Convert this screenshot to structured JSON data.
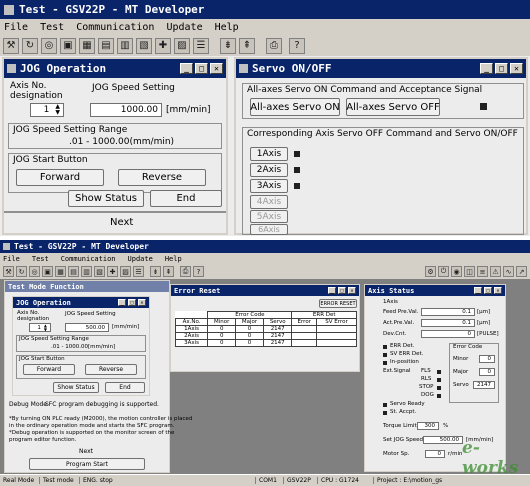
{
  "top": {
    "title": "Test - GSV22P - MT Developer",
    "menu": [
      "File",
      "Test",
      "Communication",
      "Update",
      "Help"
    ],
    "jog": {
      "title": "JOG Operation",
      "axis_no_label": "Axis No.",
      "designation_label": "designation",
      "axis_value": "1",
      "speed_setting_label": "JOG Speed Setting",
      "speed_value": "1000.00",
      "speed_unit": "[mm/min]",
      "range_label": "JOG Speed Setting Range",
      "range_value": ".01 - 1000.00(mm/min)",
      "start_label": "JOG Start Button",
      "forward": "Forward",
      "reverse": "Reverse",
      "show_status": "Show Status",
      "end": "End",
      "below_text": "Next"
    },
    "servo": {
      "title": "Servo ON/OFF",
      "all_group_label": "All-axes Servo ON Command and Acceptance Signal",
      "all_on": "All-axes Servo ON",
      "all_off": "All-axes Servo OFF",
      "axis_group_label": "Corresponding Axis Servo OFF Command and Servo ON/OFF",
      "axes": [
        "1Axis",
        "2Axis",
        "3Axis",
        "4Axis",
        "5Axis",
        "6Axis"
      ]
    }
  },
  "bottom": {
    "title": "Test - GSV22P - MT Developer",
    "menu": [
      "File",
      "Test",
      "Communication",
      "Update",
      "Help"
    ],
    "mode_title": "Test Mode Function",
    "jog": {
      "title": "JOG Operation",
      "axis_no_label": "Axis No.",
      "designation_label": "designation",
      "axis_value": "1",
      "speed_setting_label": "JOG Speed Setting",
      "speed_value": "500.00",
      "speed_unit": "[mm/min]",
      "range_label": "JOG Speed Setting Range",
      "range_value": ".01 - 1000.00[mm/min]",
      "start_label": "JOG Start Button",
      "forward": "Forward",
      "reverse": "Reverse",
      "show_status": "Show Status",
      "end": "End"
    },
    "debug_mode_label": "Debug Mode",
    "debug_mode_text": "SFC program debugging is supported.",
    "notes": [
      "*By turning ON PLC ready (M2000), the motion controller is placed",
      "  in the ordinary operation mode and starts the SFC program.",
      "  *Debug operation is supported on the monitor screen of the",
      "  program editor function."
    ],
    "next_label": "Next",
    "program_start": "Program Start",
    "error_reset_win": {
      "title": "Error Reset",
      "button": "ERROR RESET",
      "headers_top": [
        "Error Code",
        "ERR Det"
      ],
      "headers": [
        "Ax.No.",
        "Minor",
        "Major",
        "Servo",
        "Error",
        "SV Error"
      ],
      "rows": [
        [
          "1Axis",
          "0",
          "0",
          "2147",
          "",
          ""
        ],
        [
          "2Axis",
          "0",
          "0",
          "2147",
          "",
          ""
        ],
        [
          "3Axis",
          "0",
          "0",
          "2147",
          "",
          ""
        ]
      ]
    },
    "axis_status": {
      "title": "Axis Status",
      "axis_label": "1Axis",
      "feed_label": "Feed Pre.Val.",
      "feed_value": "0.1",
      "feed_unit": "[µm]",
      "act_label": "Act.Pre.Val.",
      "act_value": "0.1",
      "act_unit": "[µm]",
      "dev_label": "Dev.Cnt.",
      "dev_value": "0",
      "dev_unit": "[PULSE]",
      "err_det": "ERR Det.",
      "sv_err_det": "SV ERR Det.",
      "in_position": "In-position",
      "ext_signal": "Ext.Signal",
      "ext_items": [
        "FLS",
        "RLS",
        "STOP",
        "DOG"
      ],
      "error_code_label": "Error Code",
      "minor_label": "Minor",
      "minor_value": "0",
      "major_label": "Major",
      "major_value": "0",
      "servo_label": "Servo",
      "servo_value": "2147",
      "servo_ready": "Servo Ready",
      "st_accpt": "St. Accpt.",
      "torque_label": "Torque Limit",
      "torque_value": "300",
      "torque_unit": "%",
      "set_jog_label": "Set JOG Speed",
      "set_jog_value": "500.00",
      "set_jog_unit": "[mm/min]",
      "motor_label": "Motor Sp.",
      "motor_value": "0",
      "motor_unit": "r/min"
    },
    "status_bar": [
      "Real Mode",
      "Test mode",
      "ENG. stop",
      "COM1",
      "GSV22P",
      "CPU : G1724",
      "Project : E:\\motion_gs"
    ]
  },
  "watermark": "e-works"
}
